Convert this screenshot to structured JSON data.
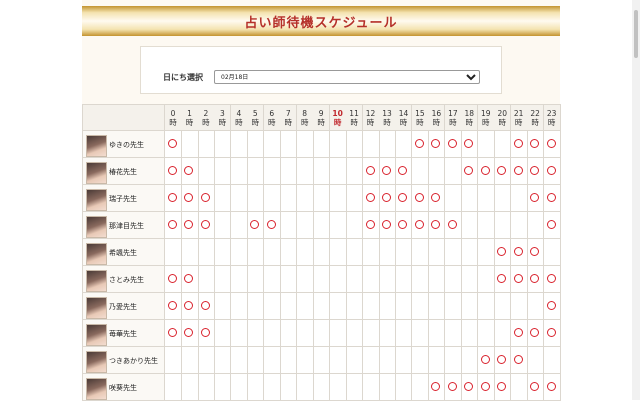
{
  "page_title": "占い師待機スケジュール",
  "date_selector": {
    "label": "日にち選択",
    "selected": "02月18日"
  },
  "current_hour_label": "10",
  "hours": [
    {
      "num": "0",
      "unit": "時"
    },
    {
      "num": "1",
      "unit": "時"
    },
    {
      "num": "2",
      "unit": "時"
    },
    {
      "num": "3",
      "unit": "時"
    },
    {
      "num": "4",
      "unit": "時"
    },
    {
      "num": "5",
      "unit": "時"
    },
    {
      "num": "6",
      "unit": "時"
    },
    {
      "num": "7",
      "unit": "時"
    },
    {
      "num": "8",
      "unit": "時"
    },
    {
      "num": "9",
      "unit": "時"
    },
    {
      "num": "10",
      "unit": "時"
    },
    {
      "num": "11",
      "unit": "時"
    },
    {
      "num": "12",
      "unit": "時"
    },
    {
      "num": "13",
      "unit": "時"
    },
    {
      "num": "14",
      "unit": "時"
    },
    {
      "num": "15",
      "unit": "時"
    },
    {
      "num": "16",
      "unit": "時"
    },
    {
      "num": "17",
      "unit": "時"
    },
    {
      "num": "18",
      "unit": "時"
    },
    {
      "num": "19",
      "unit": "時"
    },
    {
      "num": "20",
      "unit": "時"
    },
    {
      "num": "21",
      "unit": "時"
    },
    {
      "num": "22",
      "unit": "時"
    },
    {
      "num": "23",
      "unit": "時"
    }
  ],
  "availability_mark": "circle",
  "colors": {
    "title_text": "#b5302a",
    "mark": "#d9232e",
    "current_hour": "#c0272d",
    "gold": "#c3932f"
  },
  "teachers": [
    {
      "name": "ゆきの先生",
      "hours": [
        0,
        15,
        16,
        17,
        18,
        21,
        22,
        23
      ]
    },
    {
      "name": "椿花先生",
      "hours": [
        0,
        1,
        12,
        13,
        14,
        18,
        19,
        20,
        21,
        22,
        23
      ]
    },
    {
      "name": "瑞子先生",
      "hours": [
        0,
        1,
        2,
        12,
        13,
        14,
        15,
        16,
        22,
        23
      ]
    },
    {
      "name": "那津目先生",
      "hours": [
        0,
        1,
        2,
        5,
        6,
        12,
        13,
        14,
        15,
        16,
        17,
        23
      ]
    },
    {
      "name": "希颯先生",
      "hours": [
        20,
        21,
        22
      ]
    },
    {
      "name": "さとみ先生",
      "hours": [
        0,
        1,
        20,
        21,
        22,
        23
      ]
    },
    {
      "name": "乃愛先生",
      "hours": [
        0,
        1,
        2,
        23
      ]
    },
    {
      "name": "苺華先生",
      "hours": [
        0,
        1,
        2,
        21,
        22,
        23
      ]
    },
    {
      "name": "つきあかり先生",
      "hours": [
        19,
        20,
        21
      ]
    },
    {
      "name": "咲葵先生",
      "hours": [
        16,
        17,
        18,
        19,
        20,
        22,
        23
      ]
    }
  ]
}
